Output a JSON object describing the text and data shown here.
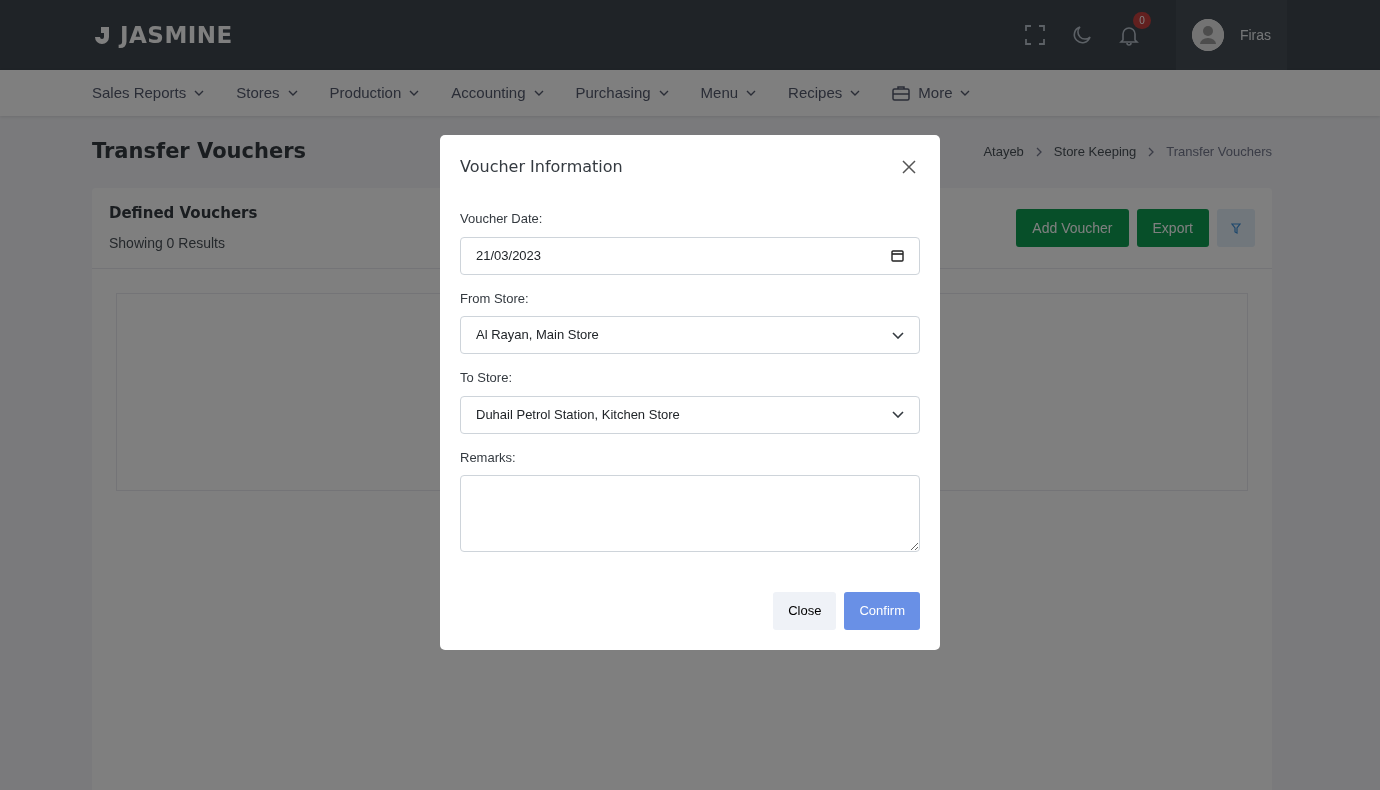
{
  "brand": "JASMINE",
  "header": {
    "notifications": "0",
    "user": "Firas"
  },
  "menu": [
    {
      "label": "Sales Reports",
      "kind": "plain"
    },
    {
      "label": "Stores",
      "kind": "plain"
    },
    {
      "label": "Production",
      "kind": "plain"
    },
    {
      "label": "Accounting",
      "kind": "plain"
    },
    {
      "label": "Purchasing",
      "kind": "plain"
    },
    {
      "label": "Menu",
      "kind": "plain"
    },
    {
      "label": "Recipes",
      "kind": "plain"
    },
    {
      "label": "More",
      "kind": "icon"
    }
  ],
  "page_title": "Transfer Vouchers",
  "breadcrumb": [
    {
      "label": "Atayeb",
      "selected": false
    },
    {
      "label": "Store Keeping",
      "selected": false
    },
    {
      "label": "Transfer Vouchers",
      "selected": true
    }
  ],
  "card": {
    "title": "Defined Vouchers",
    "subtitle": "Showing 0 Results",
    "buttons": [
      "Add Voucher",
      "Export"
    ]
  },
  "modal": {
    "title": "Voucher Information",
    "fields": [
      {
        "label": "Voucher Date:",
        "kind": "date",
        "value": "21/03/2023"
      },
      {
        "label": "From Store:",
        "kind": "select",
        "value": "Al Rayan, Main Store"
      },
      {
        "label": "To Store:",
        "kind": "select",
        "value": "Duhail Petrol Station, Kitchen Store"
      },
      {
        "label": "Remarks:",
        "kind": "textarea"
      }
    ],
    "buttons": [
      {
        "label": "Close",
        "kind": "secondary"
      },
      {
        "label": "Confirm",
        "kind": "primary"
      }
    ]
  }
}
